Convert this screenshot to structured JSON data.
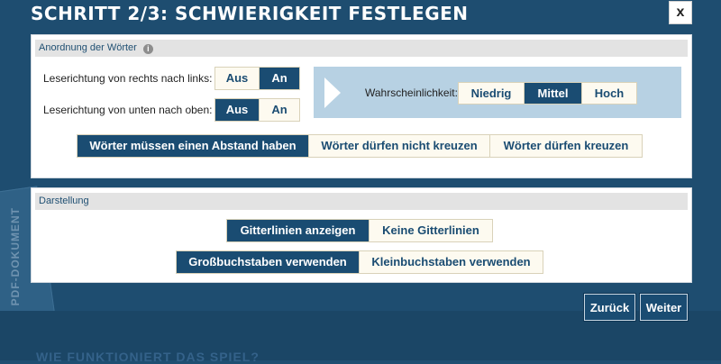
{
  "modal": {
    "title": "SCHRITT 2/3: SCHWIERIGKEIT FESTLEGEN",
    "close": "x"
  },
  "background": {
    "doc_text": "PDF-DOKUMENT",
    "bottom_text": "WIE FUNKTIONIERT DAS SPIEL?"
  },
  "arrangement": {
    "heading": "Anordnung der Wörter",
    "info_icon": "i",
    "rtl": {
      "label": "Leserichtung von rechts nach links:",
      "options": [
        "Aus",
        "An"
      ],
      "selected": "An"
    },
    "btt": {
      "label": "Leserichtung von unten nach oben:",
      "options": [
        "Aus",
        "An"
      ],
      "selected": "Aus"
    },
    "probability": {
      "label": "Wahrscheinlichkeit:",
      "options": [
        "Niedrig",
        "Mittel",
        "Hoch"
      ],
      "selected": "Mittel"
    },
    "spacing": {
      "options": [
        "Wörter müssen einen Abstand haben",
        "Wörter dürfen nicht kreuzen",
        "Wörter dürfen kreuzen"
      ],
      "selected": "Wörter müssen einen Abstand haben"
    }
  },
  "display": {
    "heading": "Darstellung",
    "grid": {
      "options": [
        "Gitterlinien anzeigen",
        "Keine Gitterlinien"
      ],
      "selected": "Gitterlinien anzeigen"
    },
    "case": {
      "options": [
        "Großbuchstaben verwenden",
        "Kleinbuchstaben verwenden"
      ],
      "selected": "Großbuchstaben verwenden"
    }
  },
  "footer": {
    "back": "Zurück",
    "next": "Weiter"
  }
}
